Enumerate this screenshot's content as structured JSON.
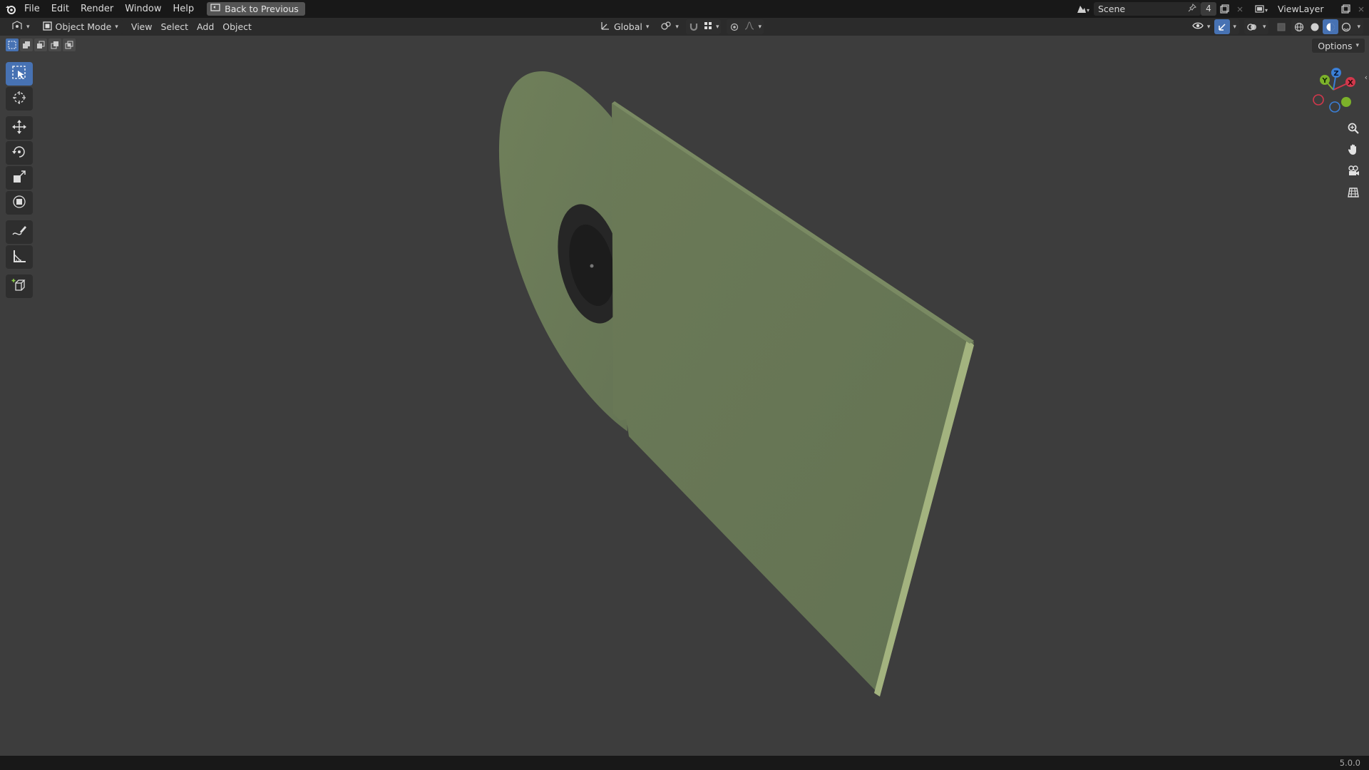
{
  "menu": {
    "items": [
      "File",
      "Edit",
      "Render",
      "Window",
      "Help"
    ],
    "back_button": "Back to Previous"
  },
  "scene": {
    "name": "Scene",
    "count": "4"
  },
  "view_layer": {
    "name": "ViewLayer"
  },
  "header": {
    "mode": "Object Mode",
    "menus": [
      "View",
      "Select",
      "Add",
      "Object"
    ],
    "orientation": "Global"
  },
  "options_label": "Options",
  "gizmo": {
    "x_label": "X",
    "y_label": "Y",
    "z_label": "Z"
  },
  "status": {
    "version": "5.0.0"
  },
  "colors": {
    "accent": "#4772b3",
    "viewport_bg": "#3d3d3d",
    "object": "#6b7a58",
    "axis_x": "#d2384c",
    "axis_y": "#7cb22a",
    "axis_z": "#3b7fd6"
  },
  "icons": {
    "tools": [
      "select-box-icon",
      "cursor-icon",
      "move-icon",
      "rotate-icon",
      "scale-icon",
      "transform-icon",
      "annotate-icon",
      "measure-icon",
      "add-cube-icon"
    ],
    "nav": [
      "zoom-icon",
      "hand-pan-icon",
      "camera-icon",
      "grid-icon"
    ]
  }
}
